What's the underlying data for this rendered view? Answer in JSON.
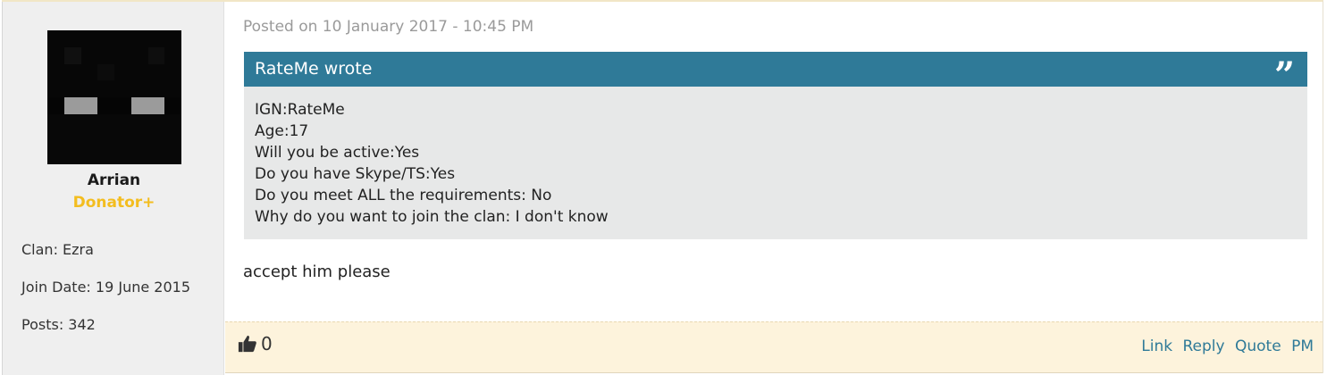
{
  "author": {
    "username": "Arrian",
    "rank": "Donator+",
    "stats": [
      {
        "label": "Clan: Ezra"
      },
      {
        "label": "Join Date: 19 June 2015"
      },
      {
        "label": "Posts: 342"
      }
    ]
  },
  "post": {
    "posted": "Posted on 10 January 2017 - 10:45 PM",
    "quote": {
      "header": "RateMe wrote",
      "icon": "”",
      "lines": [
        "IGN:RateMe",
        "Age:17",
        "Will you be active:Yes",
        "Do you have Skype/TS:Yes",
        "Do you meet ALL the requirements: No",
        "Why do you want to join the clan: I don't know"
      ]
    },
    "message": "accept him please"
  },
  "footer": {
    "like_count": "0",
    "actions": [
      "Link",
      "Reply",
      "Quote",
      "PM"
    ]
  },
  "colors": {
    "quote_header": "#2f7a98",
    "rank": "#f3bd1f",
    "footer_bg": "#fdf3dc"
  }
}
